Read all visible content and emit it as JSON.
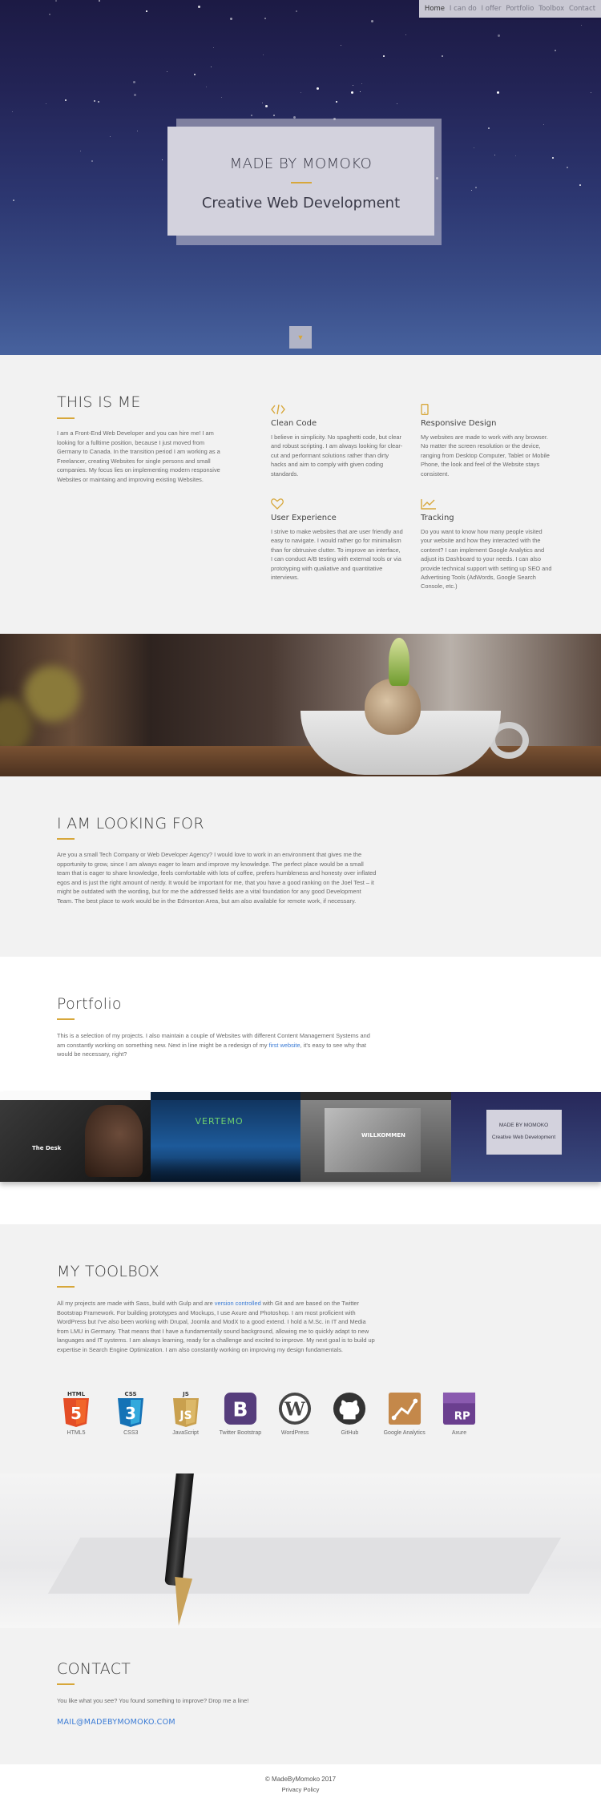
{
  "nav": {
    "items": [
      "Home",
      "I can do",
      "I offer",
      "Portfolio",
      "Toolbox",
      "Contact"
    ]
  },
  "hero": {
    "title": "MADE BY MOMOKO",
    "subtitle": "Creative Web Development",
    "scroll_icon": "chevron-down"
  },
  "about": {
    "heading": "THIS IS ME",
    "text": "I am a Front-End Web Developer and you can hire me! I am looking for a fulltime position, because I just moved from Germany to Canada. In the transition period I am working as a Freelancer, creating Websites for single persons and small companies. My focus lies on implementing modern responsive Websites or maintaing and improving existing Websites.",
    "features": [
      {
        "icon": "code-icon",
        "title": "Clean Code",
        "text": "I believe in simplicity. No spaghetti code, but clear and robust scripting. I am always looking for clear-cut and performant solutions rather than dirty hacks and aim to comply with given coding standards."
      },
      {
        "icon": "mobile-icon",
        "title": "Responsive Design",
        "text": "My websites are made to work with any browser. No matter the screen resolution or the device, ranging from Desktop Computer, Tablet or Mobile Phone, the look and feel of the Website stays consistent."
      },
      {
        "icon": "heart-icon",
        "title": "User Experience",
        "text": "I strive to make websites that are user friendly and easy to navigate. I would rather go for minimalism than for obtrusive clutter. To improve an interface, I can conduct A/B testing with external tools or via prototyping with qualiative and quantitative interviews."
      },
      {
        "icon": "chart-icon",
        "title": "Tracking",
        "text": "Do you want to know how many people visited your website and how they interacted with the content? I can implement Google Analytics and adjust its Dashboard to your needs. I can also provide technical support with setting up SEO and Advertising Tools (AdWords, Google Search Console, etc.)"
      }
    ]
  },
  "looking": {
    "heading": "I AM LOOKING FOR",
    "text": "Are you a small Tech Company or Web Developer Agency? I would love to work in an environment that gives me the opportunity to grow, since I am always eager to learn and improve my knowledge. The perfect place would be a small team that is eager to share knowledge, feels comfortable with lots of coffee, prefers humbleness and honesty over inflated egos and is just the right amount of nerdy. It would be important for me, that you have a good ranking on the Joel Test – it might be outdated with the wording, but for me the addressed fields are a vital foundation for any good Development Team. The best place to work would be in the Edmonton Area, but am also available for remote work, if necessary."
  },
  "portfolio": {
    "heading": "Portfolio",
    "text_before": "This is a selection of my projects. I also maintain a couple of Websites with different Content Management Systems and am constantly working on something new. Next in line might be a redesign of my ",
    "link": "first website",
    "text_after": ", it's easy to see why that would be necessary, right?",
    "shots": [
      {
        "label": "The Desk",
        "bg": "#2a2a2a"
      },
      {
        "label": "VERTEMO",
        "bg": "#1d4f86"
      },
      {
        "label": "WILLKOMMEN",
        "bg": "#5d5d5d"
      },
      {
        "label": "MADE BY MOMOKO",
        "sub": "Creative Web Development",
        "bg": "#2e2f5e"
      }
    ]
  },
  "toolbox": {
    "heading": "MY TOOLBOX",
    "text_1": "All my projects are made with Sass, build with Gulp and are ",
    "link": "version controlled",
    "text_2": " with Git and are based on the Twitter Bootstrap Framework. For building prototypes and Mockups, I use Axure and Photoshop. I am most proficient with WordPress but I've also been working with Drupal, Joomla and ModX to a good extend. I hold a M.Sc. in IT and Media from LMU in Germany. That means that I have a fundamentally sound background, allowing me to quickly adapt to new languages and IT systems. I am always learning, ready for a challenge and excited to improve. My next goal is to build up expertise in Search Engine Optimization. I am also constantly working on improving my design fundamentals.",
    "tools": [
      {
        "name": "HTML5",
        "icon": "html5-icon",
        "color": "#e44d26",
        "tag": "HTML"
      },
      {
        "name": "CSS3",
        "icon": "css3-icon",
        "color": "#1572b6",
        "tag": "CSS"
      },
      {
        "name": "JavaScript",
        "icon": "javascript-icon",
        "color": "#c9a04e",
        "tag": "JS"
      },
      {
        "name": "Twitter Bootstrap",
        "icon": "bootstrap-icon",
        "color": "#563d7c"
      },
      {
        "name": "WordPress",
        "icon": "wordpress-icon",
        "color": "#464646"
      },
      {
        "name": "GitHub",
        "icon": "github-icon",
        "color": "#333333"
      },
      {
        "name": "Google Analytics",
        "icon": "analytics-icon",
        "color": "#c4884a"
      },
      {
        "name": "Axure",
        "icon": "axure-icon",
        "color": "#6b3f8f",
        "tag": "RP"
      }
    ]
  },
  "contact": {
    "heading": "CONTACT",
    "text": "You like what you see? You found something to improve? Drop me a line!",
    "email": "MAIL@MADEBYMOMOKO.COM"
  },
  "footer": {
    "copyright": "© MadeByMomoko 2017",
    "privacy": "Privacy Policy"
  },
  "colors": {
    "accent": "#d7a73a",
    "link": "#3a7bd5",
    "hero_top": "#1c1a44",
    "hero_bottom": "#47629e"
  }
}
